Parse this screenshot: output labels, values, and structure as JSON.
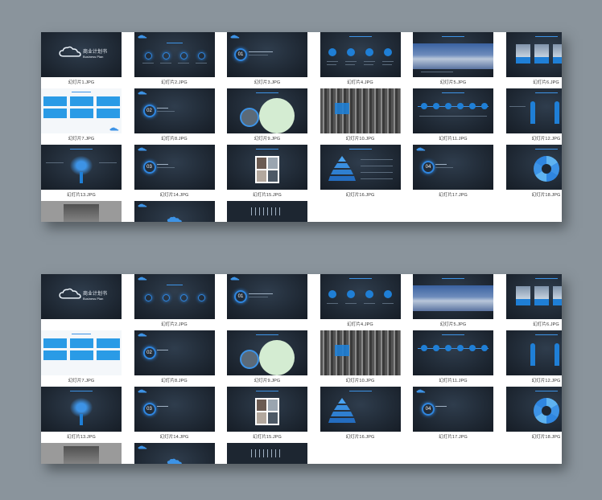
{
  "panels": [
    {
      "captions": [
        "幻灯片1.JPG",
        "幻灯片2.JPG",
        "幻灯片3.JPG",
        "幻灯片4.JPG",
        "幻灯片5.JPG",
        "幻灯片6.JPG",
        "幻灯片7.JPG",
        "幻灯片8.JPG",
        "幻灯片9.JPG",
        "幻灯片10.JPG",
        "幻灯片11.JPG",
        "幻灯片12.JPG",
        "幻灯片13.JPG",
        "幻灯片14.JPG",
        "幻灯片15.JPG",
        "幻灯片16.JPG",
        "幻灯片17.JPG",
        "幻灯片18.JPG"
      ]
    },
    {
      "captions": [
        "",
        "幻灯片2.JPG",
        "",
        "幻灯片4.JPG",
        "幻灯片5.JPG",
        "幻灯片6.JPG",
        "幻灯片7.JPG",
        "幻灯片8.JPG",
        "幻灯片9.JPG",
        "幻灯片10.JPG",
        "幻灯片11.JPG",
        "幻灯片12.JPG",
        "幻灯片13.JPG",
        "幻灯片14.JPG",
        "幻灯片15.JPG",
        "幻灯片16.JPG",
        "幻灯片17.JPG",
        "幻灯片18.JPG"
      ]
    }
  ],
  "slide_text": {
    "title_cn": "商业计划书",
    "title_en": "Business Plan",
    "num_01": "01",
    "num_02": "02",
    "num_03": "03",
    "num_04": "04"
  },
  "colors": {
    "accent": "#1f7fd6",
    "slide_bg": "#1d2631",
    "page_bg": "#8a949c"
  }
}
